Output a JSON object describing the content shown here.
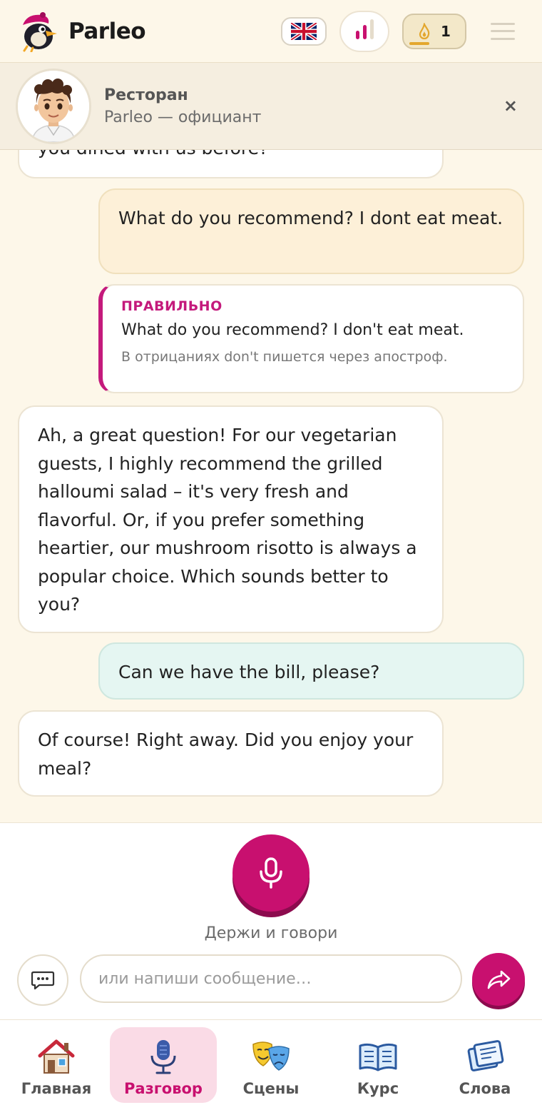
{
  "app": {
    "name": "Parleo"
  },
  "header": {
    "language_flag": "uk-flag-icon",
    "streak_count": "1"
  },
  "scene": {
    "title": "Ресторан",
    "subtitle": "Parleo — официант",
    "close_label": "×"
  },
  "messages": {
    "partial_bot": "you dined with us before?",
    "user1": "What do you recommend? I dont eat meat.",
    "correction_label": "ПРАВИЛЬНО",
    "correction_text": "What do you recommend? I don't eat meat.",
    "correction_note": "В отрицаниях don't пишется через апостроф.",
    "bot1": "Ah, a great question! For our vegetarian guests, I highly recommend the grilled halloumi salad – it's very fresh and flavorful. Or, if you prefer something heartier, our mushroom risotto is always a popular choice. Which sounds better to you?",
    "user2": "Can we have the bill, please?",
    "bot2": "Of course! Right away. Did you enjoy your meal?"
  },
  "composer": {
    "hold_label": "Держи и говори",
    "placeholder": "или напиши сообщение…"
  },
  "nav": {
    "home": "Главная",
    "talk": "Разговор",
    "scenes": "Сцены",
    "course": "Курс",
    "words": "Слова"
  },
  "colors": {
    "accent": "#c8106f",
    "background": "#fdf7e9",
    "streak": "#e3a72e"
  }
}
